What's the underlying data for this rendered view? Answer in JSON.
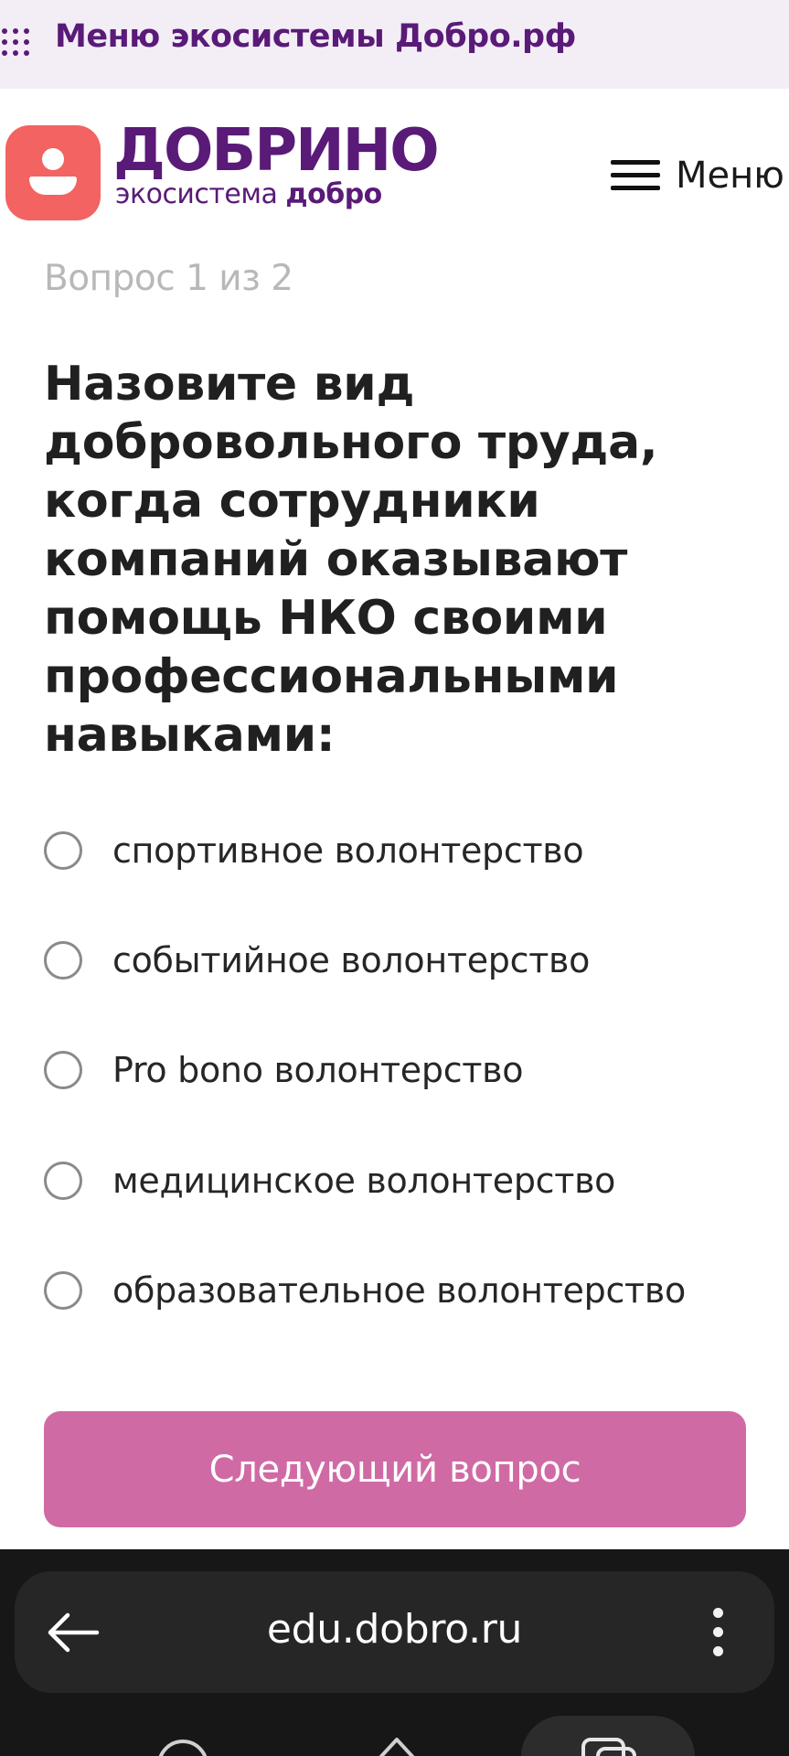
{
  "eco_bar": {
    "title": "Меню экосистемы Добро.рф",
    "icon": "grid-dots-icon"
  },
  "header": {
    "brand_name": "ДОБРИНО",
    "brand_sub_prefix": "экосистема ",
    "brand_sub_strong": "добро",
    "logo_icon": "person-logo-icon",
    "menu_label": "Меню",
    "menu_icon": "hamburger-icon"
  },
  "quiz": {
    "counter": "Вопрос 1 из 2",
    "question": "Назовите вид добровольного труда, когда сотрудники компаний оказывают помощь НКО своими профессиональными навыками:",
    "options": [
      {
        "label": "спортивное волонтерство",
        "selected": false
      },
      {
        "label": "событийное волонтерство",
        "selected": false
      },
      {
        "label": "Pro bono волонтерство",
        "selected": false
      },
      {
        "label": "медицинское волонтерство",
        "selected": false
      },
      {
        "label": "образовательное волонтерство",
        "selected": false
      }
    ],
    "next_button": "Следующий вопрос"
  },
  "browser": {
    "url": "edu.dobro.ru",
    "back_icon": "back-arrow-icon",
    "more_icon": "more-vertical-icon"
  },
  "colors": {
    "brand_purple": "#5a1a78",
    "logo_coral": "#f26361",
    "button_pink": "#d06aa5",
    "eco_bar_bg": "#f3eef6"
  }
}
